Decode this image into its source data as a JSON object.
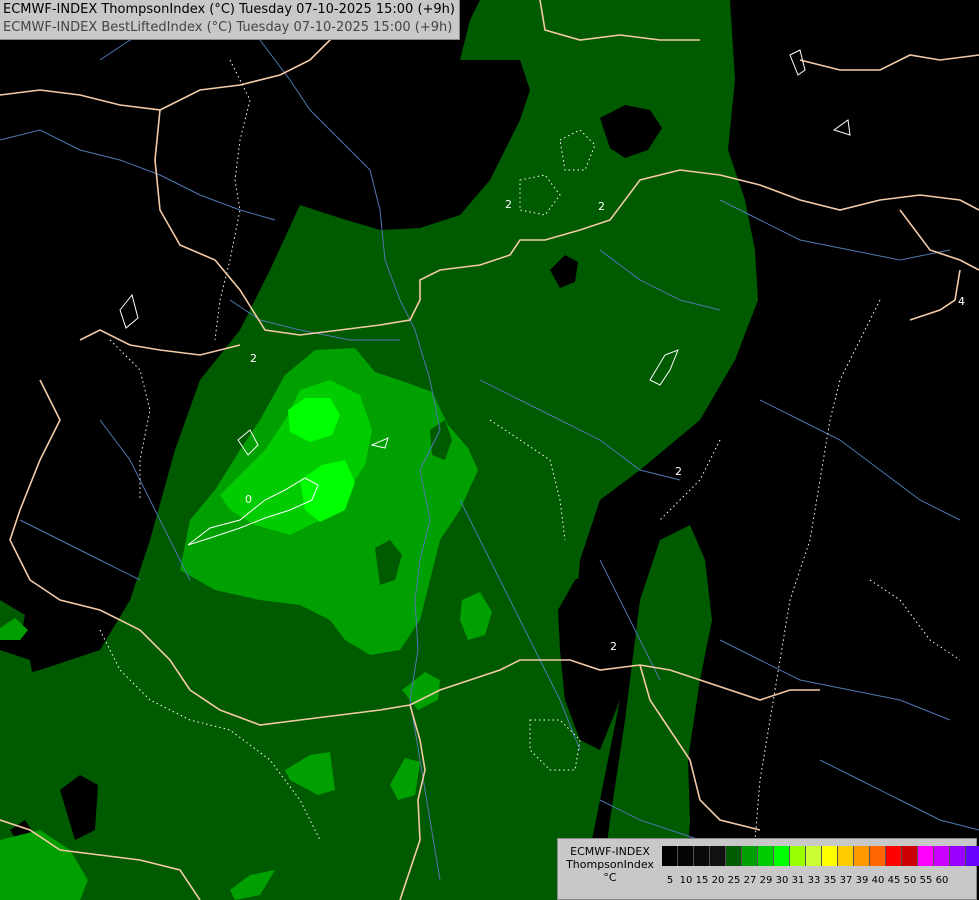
{
  "title": {
    "line1": "ECMWF-INDEX ThompsonIndex (°C) Tuesday 07-10-2025 15:00 (+9h)",
    "line2": "ECMWF-INDEX BestLiftedIndex (°C) Tuesday 07-10-2025 15:00 (+9h)"
  },
  "legend": {
    "line1": "ECMWF-INDEX",
    "line2": "ThompsonIndex",
    "line3": "°C",
    "ticks": [
      "5",
      "10",
      "15",
      "20",
      "25",
      "27",
      "29",
      "30",
      "31",
      "33",
      "35",
      "37",
      "39",
      "40",
      "45",
      "50",
      "55",
      "60"
    ],
    "colors": [
      "#000000",
      "#050505",
      "#0a0a0a",
      "#111111",
      "#005a00",
      "#00a000",
      "#00cc00",
      "#00ff00",
      "#99ff00",
      "#ccff33",
      "#ffff00",
      "#ffcc00",
      "#ff9900",
      "#ff6600",
      "#ff0000",
      "#cc0000",
      "#ff00ff",
      "#cc00ff",
      "#9900ff",
      "#6600ff",
      "#0000ff"
    ]
  },
  "contour_labels": [
    "2",
    "2",
    "2",
    "2",
    "2",
    "4",
    "0"
  ],
  "map_colors": {
    "background": "#000000",
    "fill_20_25": "#005a00",
    "fill_25_27": "#00a000",
    "fill_27_29": "#00cc00",
    "fill_29_30": "#00ff00",
    "borders": "#f5cba7",
    "rivers": "#4f78b0",
    "contours": "#ffffff"
  }
}
